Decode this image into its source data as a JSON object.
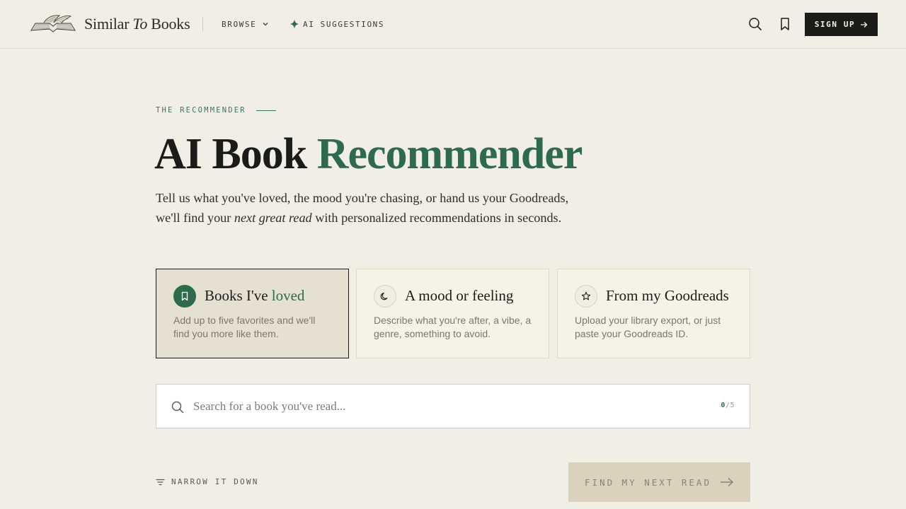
{
  "header": {
    "logo": {
      "part1": "Similar",
      "part2": "To",
      "part3": "Books",
      "icon": "open-book-icon"
    },
    "nav": {
      "browse_label": "BROWSE",
      "browse_icon": "chevron-down-icon",
      "ai_label": "AI SUGGESTIONS",
      "ai_icon": "sparkle-icon"
    },
    "search_icon": "search-icon",
    "bookmark_icon": "bookmark-icon",
    "signup_label": "SIGN UP",
    "signup_icon": "arrow-right-icon"
  },
  "hero": {
    "eyebrow": "THE RECOMMENDER",
    "title_part1": "AI Book",
    "title_part2": "Recommender",
    "subtitle_line1": "Tell us what you've loved, the mood you're chasing, or hand us your Goodreads,",
    "subtitle_pre": "we'll find your",
    "subtitle_em": "next great read",
    "subtitle_post": "with personalized recommendations in seconds."
  },
  "cards": [
    {
      "title_pre": "Books I've",
      "title_accent": "loved",
      "desc": "Add up to five favorites and we'll find you more like them.",
      "icon": "bookmark-icon",
      "active": true
    },
    {
      "title_pre": "A mood or feeling",
      "title_accent": "",
      "desc": "Describe what you're after, a vibe, a genre, something to avoid.",
      "icon": "moon-icon",
      "active": false
    },
    {
      "title_pre": "From my Goodreads",
      "title_accent": "",
      "desc": "Upload your library export, or just paste your Goodreads ID.",
      "icon": "star-icon",
      "active": false
    }
  ],
  "search": {
    "placeholder": "Search for a book you've read...",
    "value": "",
    "count_current": "0",
    "count_sep": "/",
    "count_max": "5"
  },
  "footer_actions": {
    "narrow_label": "NARROW IT DOWN",
    "narrow_icon": "filter-icon",
    "find_label": "FIND MY NEXT READ",
    "find_icon": "arrow-right-icon"
  },
  "colors": {
    "background": "#f1eee6",
    "accent_green": "#2e6b4c",
    "dark": "#1b1c1a",
    "disabled_button": "#dbd2be"
  }
}
